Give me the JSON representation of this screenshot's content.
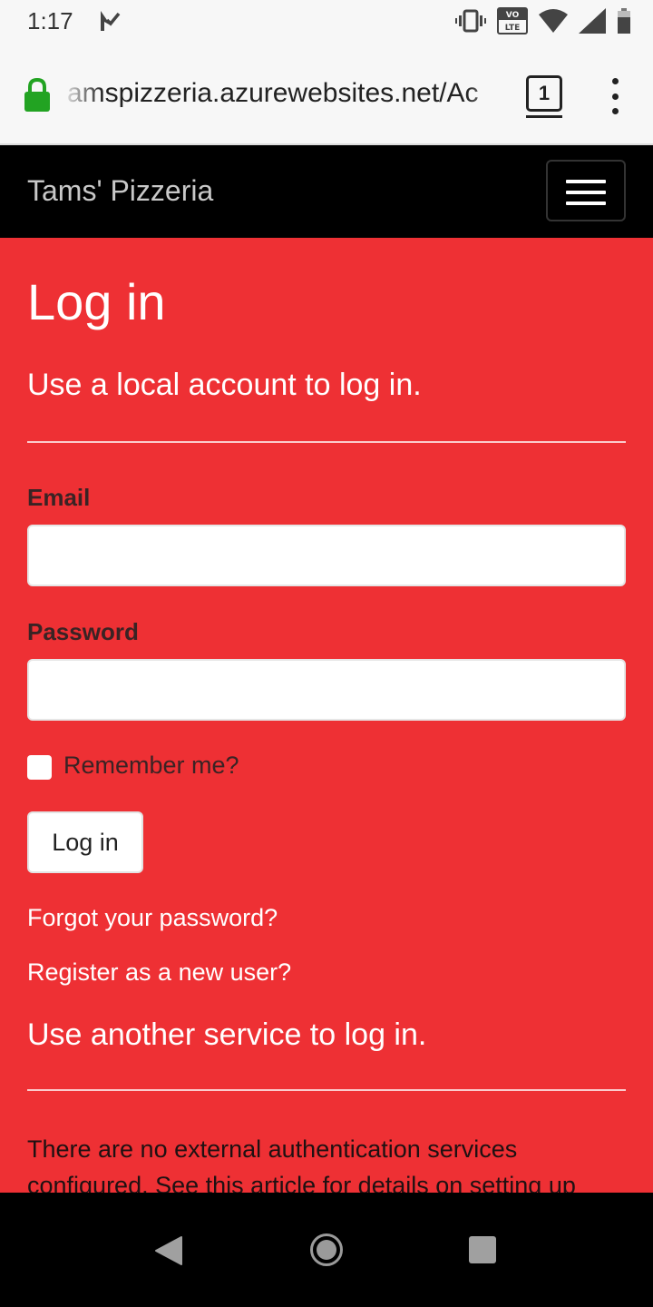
{
  "status_bar": {
    "time": "1:17",
    "network_badge_top": "VO",
    "network_badge_bottom": "LTE",
    "icons": [
      "notification-check-icon",
      "vibrate-icon",
      "volte-icon",
      "wifi-icon",
      "cell-signal-icon",
      "battery-icon"
    ]
  },
  "browser": {
    "url": "amspizzeria.azurewebsites.net/Ac",
    "tab_count": "1"
  },
  "navbar": {
    "brand": "Tams' Pizzeria"
  },
  "page": {
    "title": "Log in",
    "local_heading": "Use a local account to log in.",
    "email_label": "Email",
    "email_value": "",
    "password_label": "Password",
    "password_value": "",
    "remember_label": "Remember me?",
    "remember_checked": false,
    "login_button": "Log in",
    "forgot_link": "Forgot your password?",
    "register_link": "Register as a new user?",
    "external_heading": "Use another service to log in.",
    "external_text": "There are no external authentication services configured. See this article for details on setting up"
  },
  "colors": {
    "page_background": "#ee3034",
    "navbar_background": "#000000",
    "secure_lock": "#22a322"
  }
}
